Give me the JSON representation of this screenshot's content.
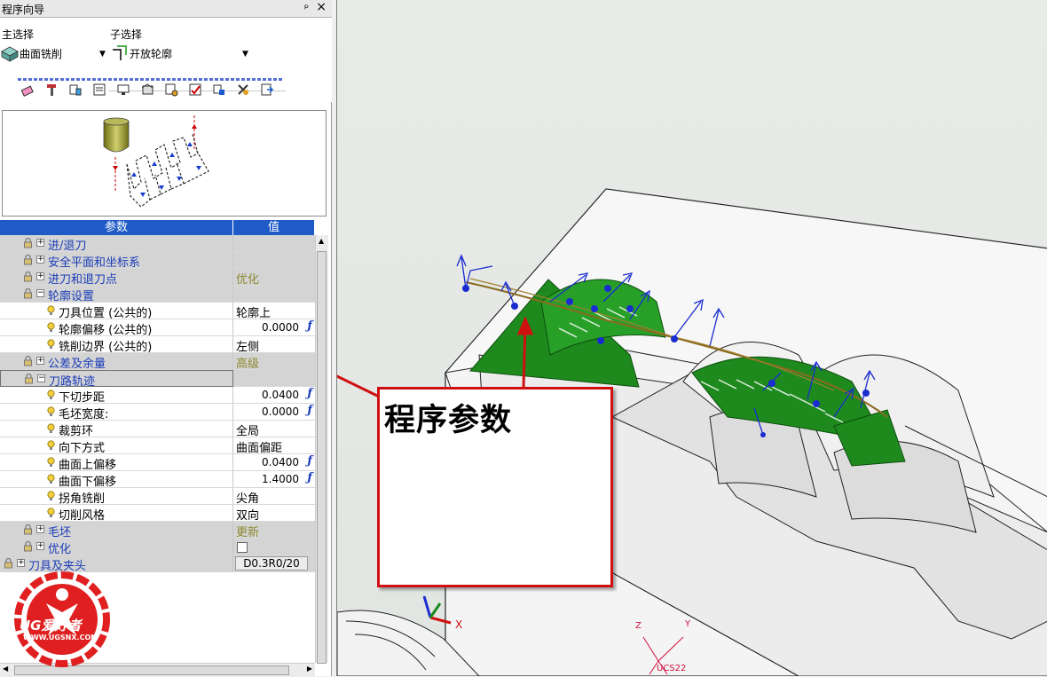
{
  "panel": {
    "title": "程序向导",
    "pin": "ᵖ",
    "close": "×",
    "main_select_label": "主选择",
    "main_select_value": "曲面铣削",
    "sub_select_label": "子选择",
    "sub_select_value": "开放轮廓"
  },
  "toolbar": {
    "icons": [
      "eraser-icon",
      "tool-icon",
      "tool-list-icon",
      "tool-params-icon",
      "display-icon",
      "calculate-icon",
      "simulate-icon",
      "report-icon",
      "save-icon",
      "settings-icon",
      "exit-icon"
    ]
  },
  "grid": {
    "header_param": "参数",
    "header_value": "值",
    "rows": [
      {
        "type": "group",
        "label": "进/退刀",
        "value": ""
      },
      {
        "type": "group",
        "label": "安全平面和坐标系",
        "value": ""
      },
      {
        "type": "group",
        "label": "进刀和退刀点",
        "value": "优化"
      },
      {
        "type": "group-open",
        "label": "轮廓设置",
        "value": ""
      },
      {
        "type": "child",
        "label": "刀具位置 (公共的)",
        "value": "轮廓上"
      },
      {
        "type": "child",
        "label": "轮廓偏移  (公共的)",
        "value": "0.0000"
      },
      {
        "type": "child",
        "label": "铣削边界 (公共的)",
        "value": "左侧"
      },
      {
        "type": "group",
        "label": "公差及余量",
        "value": "高级"
      },
      {
        "type": "group-open",
        "label": "刀路轨迹",
        "value": ""
      },
      {
        "type": "child",
        "label": "下切步距",
        "value": "0.0400"
      },
      {
        "type": "child",
        "label": "毛坯宽度:",
        "value": "0.0000"
      },
      {
        "type": "child",
        "label": "裁剪环",
        "value": "全局"
      },
      {
        "type": "child",
        "label": "向下方式",
        "value": "曲面偏距"
      },
      {
        "type": "child",
        "label": "曲面上偏移",
        "value": "0.0400"
      },
      {
        "type": "child",
        "label": "曲面下偏移",
        "value": "1.4000"
      },
      {
        "type": "child",
        "label": "拐角铣削",
        "value": "尖角"
      },
      {
        "type": "child",
        "label": "切削风格",
        "value": "双向"
      },
      {
        "type": "group",
        "label": "毛坯",
        "value": "更新"
      },
      {
        "type": "group",
        "label": "优化",
        "value": ""
      },
      {
        "type": "group",
        "label": "刀具及夹头",
        "value": "D0.3R0/20"
      }
    ]
  },
  "viewport": {
    "callout_text": "程序参数",
    "axis_x": "X",
    "axis_y": "Y",
    "axis_z": "Z",
    "ucs_label": "UCS22"
  },
  "logo": {
    "brand": "UG爱好者",
    "url": "WWW.UGSNX.COM"
  },
  "colors": {
    "header_blue": "#1e5bc6",
    "group_label_blue": "#1a3cb8",
    "group_bg": "#d4d4d4",
    "callout_red": "#cf1010",
    "toolpath_green": "#1e8a1e",
    "advanced_olive": "#8a8a30"
  }
}
